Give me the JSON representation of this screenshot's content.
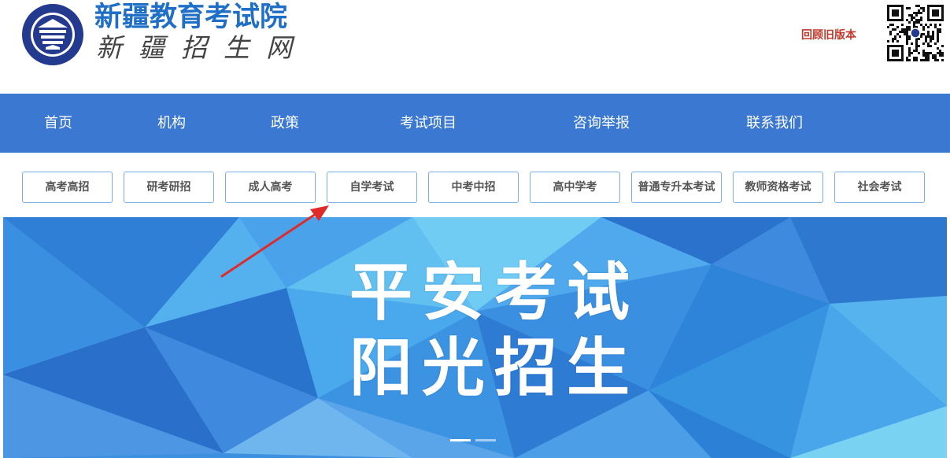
{
  "header": {
    "site_title": "新疆教育考试院",
    "site_subtitle": "新疆招生网",
    "old_version_link": "回顾旧版本",
    "qr_icon": "qr-code-icon"
  },
  "main_nav": {
    "items": [
      "首页",
      "机构",
      "政策",
      "考试项目",
      "咨询举报",
      "联系我们"
    ]
  },
  "sub_nav": {
    "items": [
      "高考高招",
      "研考研招",
      "成人高考",
      "自学考试",
      "中考中招",
      "高中学考",
      "普通专升本考试",
      "教师资格考试",
      "社会考试"
    ]
  },
  "banner": {
    "line1": "平安考试",
    "line2": "阳光招生",
    "slide_count": 2,
    "active_slide": 1
  },
  "colors": {
    "nav_bg": "#3a78d1",
    "title_blue": "#1f6fc6",
    "old_version_red": "#c0392b",
    "button_border": "#7aaee6",
    "annotation_arrow": "#e02b2b"
  }
}
